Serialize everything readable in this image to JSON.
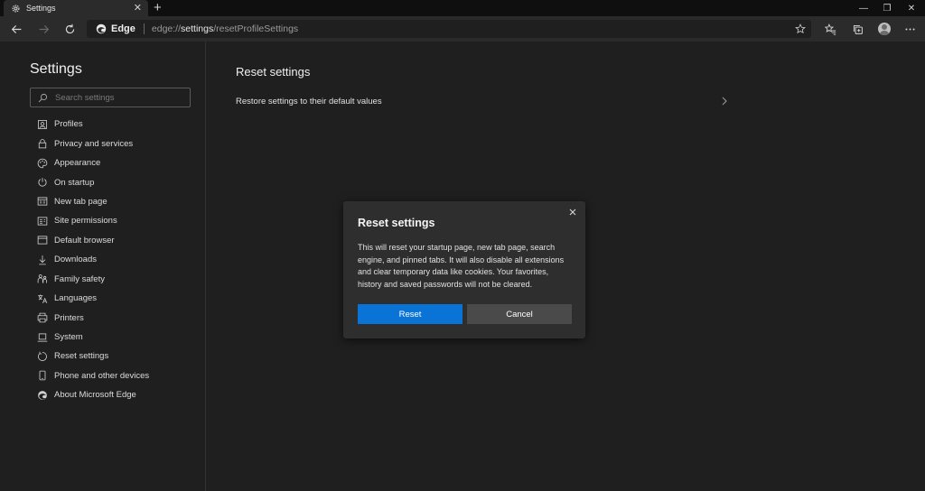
{
  "tab": {
    "title": "Settings",
    "close": "✕",
    "new_tab": "+"
  },
  "window": {
    "minimize": "—",
    "restore": "❐",
    "close": "✕"
  },
  "address": {
    "brand": "Edge",
    "url_prefix": "edge://",
    "url_bold": "settings",
    "url_rest": "/resetProfileSettings"
  },
  "sidebar": {
    "title": "Settings",
    "search_placeholder": "Search settings",
    "items": [
      {
        "label": "Profiles",
        "icon": "profile-icon"
      },
      {
        "label": "Privacy and services",
        "icon": "lock-icon"
      },
      {
        "label": "Appearance",
        "icon": "palette-icon"
      },
      {
        "label": "On startup",
        "icon": "power-icon"
      },
      {
        "label": "New tab page",
        "icon": "newtab-icon"
      },
      {
        "label": "Site permissions",
        "icon": "site-permissions-icon"
      },
      {
        "label": "Default browser",
        "icon": "browser-icon"
      },
      {
        "label": "Downloads",
        "icon": "download-icon"
      },
      {
        "label": "Family safety",
        "icon": "family-icon"
      },
      {
        "label": "Languages",
        "icon": "language-icon"
      },
      {
        "label": "Printers",
        "icon": "printer-icon"
      },
      {
        "label": "System",
        "icon": "system-icon"
      },
      {
        "label": "Reset settings",
        "icon": "reset-icon"
      },
      {
        "label": "Phone and other devices",
        "icon": "phone-icon"
      },
      {
        "label": "About Microsoft Edge",
        "icon": "edge-icon"
      }
    ]
  },
  "main": {
    "title": "Reset settings",
    "restore_row": "Restore settings to their default values"
  },
  "dialog": {
    "title": "Reset settings",
    "body": "This will reset your startup page, new tab page, search engine, and pinned tabs. It will also disable all extensions and clear temporary data like cookies. Your favorites, history and saved passwords will not be cleared.",
    "reset_label": "Reset",
    "cancel_label": "Cancel"
  },
  "colors": {
    "accent": "#0a74d6",
    "background": "#1f1f1f",
    "dialog": "#2e2e2e"
  }
}
